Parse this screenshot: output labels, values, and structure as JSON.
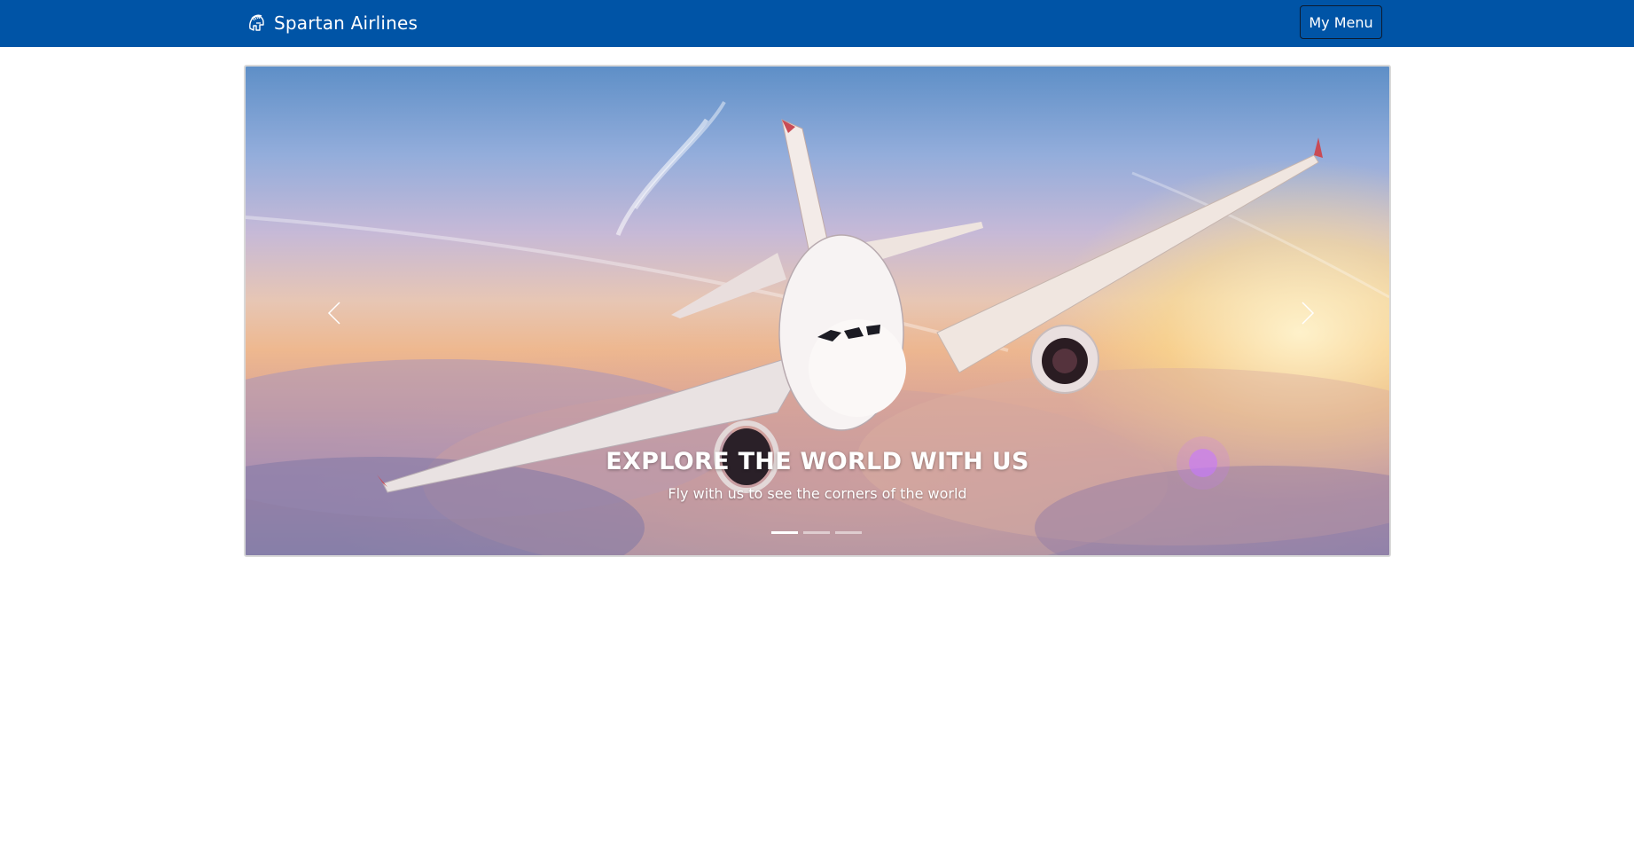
{
  "navbar": {
    "brand_name": "Spartan Airlines",
    "brand_logo_icon": "spartan-helmet-icon",
    "menu_button_label": "My Menu",
    "background_color": "#0054a6"
  },
  "carousel": {
    "slide_image": "airplane-above-clouds-sunset",
    "caption_title": "EXPLORE THE WORLD WITH US",
    "caption_subtitle": "Fly with us to see the corners of the world",
    "prev_icon": "chevron-left-icon",
    "next_icon": "chevron-right-icon",
    "indicators": [
      {
        "active": true
      },
      {
        "active": false
      },
      {
        "active": false
      }
    ]
  }
}
